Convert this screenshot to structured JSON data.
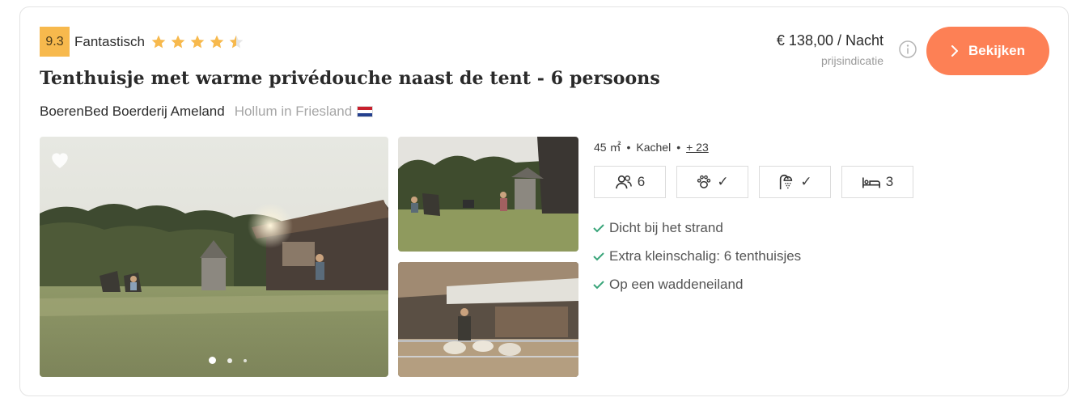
{
  "rating": {
    "score": "9.3",
    "label": "Fantastisch",
    "stars": 4.5,
    "star_color": "#f7b94d"
  },
  "listing": {
    "title": "Tenthuisje met warme privédouche naast de tent - 6 persoons",
    "host": "BoerenBed Boerderij Ameland",
    "location": "Hollum in Friesland",
    "flag_icon": "netherlands-flag-icon"
  },
  "pricing": {
    "price": "€ 138,00 / Nacht",
    "note": "prijsindicatie"
  },
  "actions": {
    "view_label": "Bekijken",
    "accent": "#fd8055"
  },
  "features": {
    "area": "45 ㎡",
    "heating": "Kachel",
    "more": "+ 23",
    "separator": "•"
  },
  "amenities": [
    {
      "icon": "people-icon",
      "value": "6"
    },
    {
      "icon": "pets-icon",
      "value": "✓"
    },
    {
      "icon": "shower-icon",
      "value": "✓"
    },
    {
      "icon": "bed-icon",
      "value": "3"
    }
  ],
  "usps": [
    "Dicht bij het strand",
    "Extra kleinschalig: 6 tenthuisjes",
    "Op een waddeneiland"
  ],
  "gallery": {
    "slides": 3,
    "active_slide": 1
  }
}
